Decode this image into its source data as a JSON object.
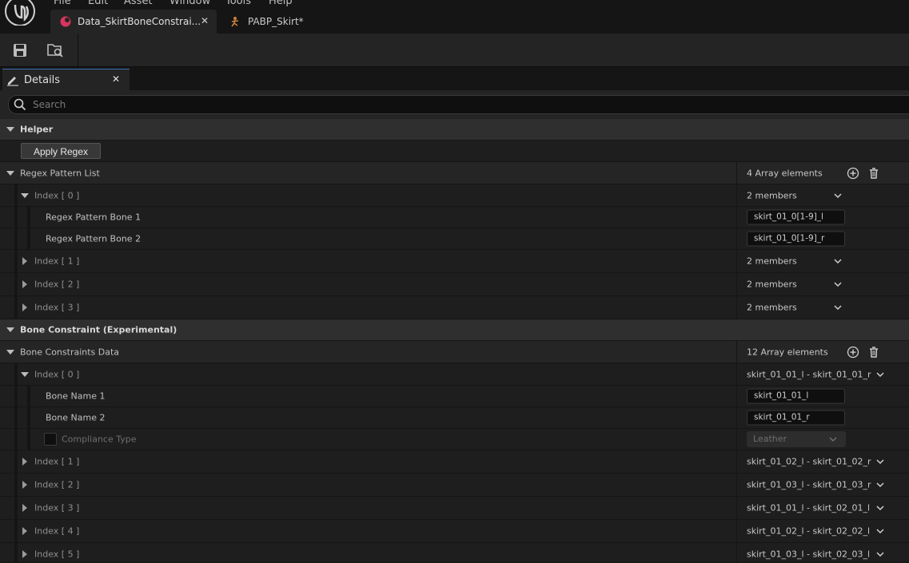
{
  "menu": [
    "File",
    "Edit",
    "Asset",
    "Window",
    "Tools",
    "Help"
  ],
  "tabs": [
    {
      "label": "Data_SkirtBoneConstrai...",
      "icon": "data-asset-icon"
    },
    {
      "label": "PABP_Skirt*",
      "icon": "anim-blueprint-icon"
    }
  ],
  "details_tab": {
    "label": "Details"
  },
  "search": {
    "placeholder": "Search"
  },
  "helper": {
    "title": "Helper",
    "button": "Apply Regex"
  },
  "regex": {
    "title": "Regex Pattern List",
    "count": "4 Array elements",
    "index0": {
      "label": "Index [ 0 ]",
      "members": "2 members",
      "bone1_label": "Regex Pattern Bone 1",
      "bone1_value": "skirt_01_0[1-9]_l",
      "bone2_label": "Regex Pattern Bone 2",
      "bone2_value": "skirt_01_0[1-9]_r"
    },
    "others": [
      {
        "label": "Index [ 1 ]",
        "members": "2 members"
      },
      {
        "label": "Index [ 2 ]",
        "members": "2 members"
      },
      {
        "label": "Index [ 3 ]",
        "members": "2 members"
      }
    ]
  },
  "bone_section": {
    "title": "Bone Constraint (Experimental)"
  },
  "bones": {
    "title": "Bone Constraints Data",
    "count": "12 Array elements",
    "index0": {
      "label": "Index [ 0 ]",
      "summary": "skirt_01_01_l - skirt_01_01_r",
      "bone1_label": "Bone Name 1",
      "bone1_value": "skirt_01_01_l",
      "bone2_label": "Bone Name 2",
      "bone2_value": "skirt_01_01_r",
      "compliance_label": "Compliance Type",
      "compliance_value": "Leather"
    },
    "others": [
      {
        "label": "Index [ 1 ]",
        "summary": "skirt_01_02_l - skirt_01_02_r"
      },
      {
        "label": "Index [ 2 ]",
        "summary": "skirt_01_03_l - skirt_01_03_r"
      },
      {
        "label": "Index [ 3 ]",
        "summary": "skirt_01_01_l - skirt_02_01_l"
      },
      {
        "label": "Index [ 4 ]",
        "summary": "skirt_01_02_l - skirt_02_02_l"
      },
      {
        "label": "Index [ 5 ]",
        "summary": "skirt_01_03_l - skirt_02_03_l"
      }
    ]
  }
}
